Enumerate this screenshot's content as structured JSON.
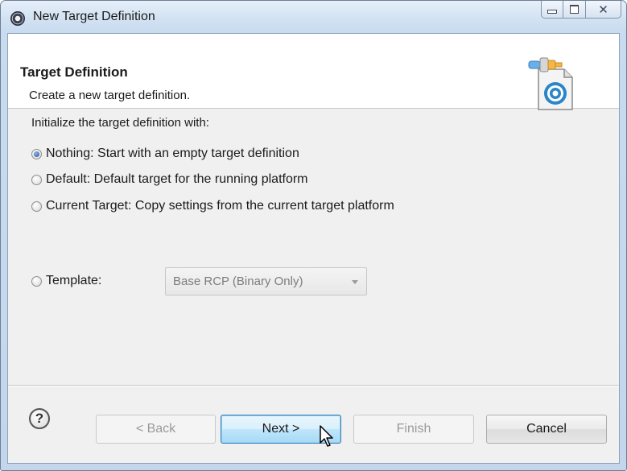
{
  "window": {
    "title": "New Target Definition",
    "icon": "eclipse-icon",
    "controls": [
      "minimize",
      "maximize",
      "close"
    ]
  },
  "header": {
    "title": "Target Definition",
    "description": "Create a new target definition.",
    "icon": "target-definition-wizard-icon"
  },
  "form": {
    "group_label": "Initialize the target definition with:",
    "options": [
      {
        "label": "Nothing: Start with an empty target definition",
        "checked": true
      },
      {
        "label": "Default: Default target for the running platform",
        "checked": false
      },
      {
        "label": "Current Target: Copy settings from the current target platform",
        "checked": false
      },
      {
        "label": "Template:",
        "checked": false
      }
    ],
    "template_combo": {
      "value": "Base RCP (Binary Only)",
      "enabled": false
    }
  },
  "footer": {
    "help_label": "?",
    "back_label": "< Back",
    "next_label": "Next >",
    "finish_label": "Finish",
    "cancel_label": "Cancel"
  },
  "colors": {
    "default_button_border": "#3c7fb1",
    "frame": "#c9dbee"
  }
}
